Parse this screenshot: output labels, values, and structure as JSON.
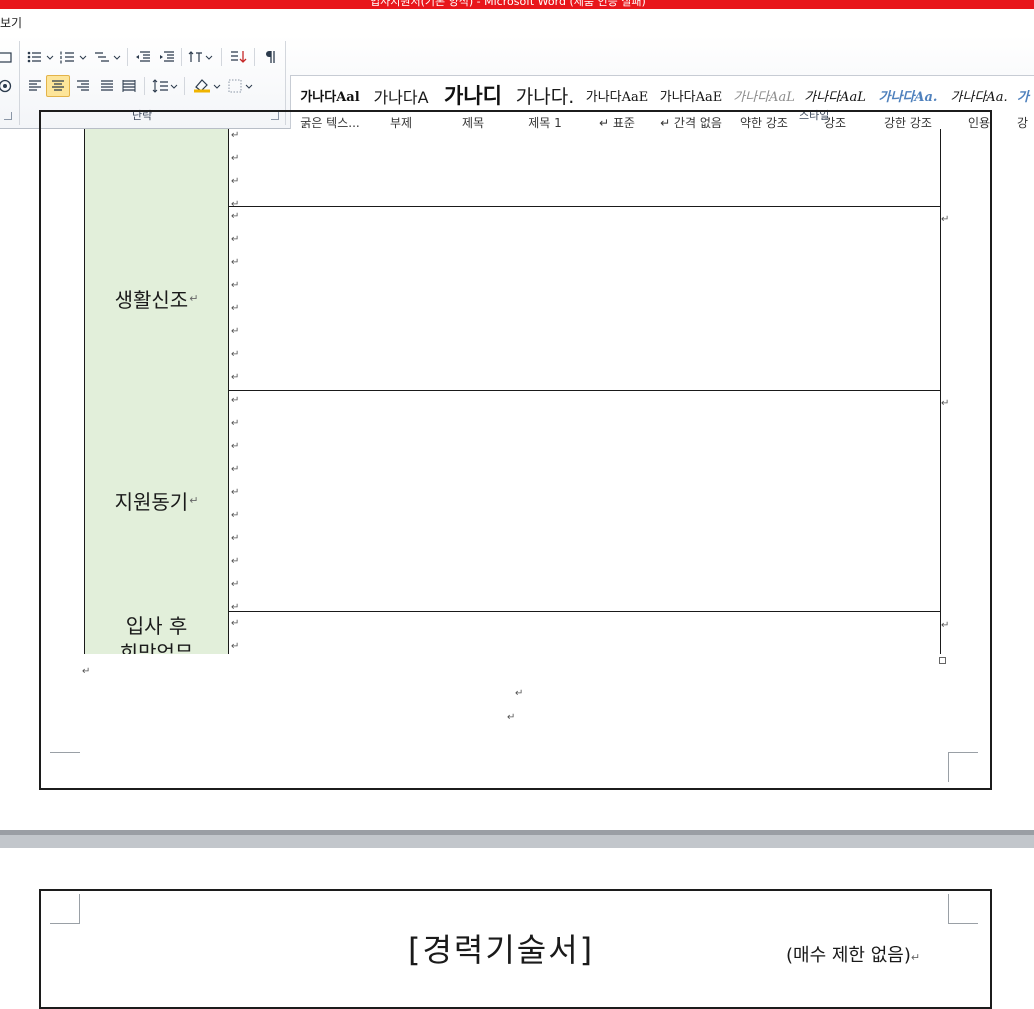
{
  "window": {
    "title": "입사지원서(기본 양식) - Microsoft Word (제품 인증 실패)"
  },
  "menu": {
    "tab_view": "보기"
  },
  "ribbon": {
    "paragraph_group_label": "단락",
    "styles_group_label": "스타일",
    "styles": [
      {
        "sample": "가나다Aal",
        "name": "굵은 텍스..."
      },
      {
        "sample": "가나다A",
        "name": "부제"
      },
      {
        "sample": "가나디",
        "name": "제목"
      },
      {
        "sample": "가나다.",
        "name": "제목 1"
      },
      {
        "sample": "가나다AaE",
        "name": "↵ 표준"
      },
      {
        "sample": "가나다AaE",
        "name": "↵ 간격 없음"
      },
      {
        "sample": "가나다AaL",
        "name": "약한 강조"
      },
      {
        "sample": "가나다AaL",
        "name": "강조"
      },
      {
        "sample": "가나다Aa.",
        "name": "강한 강조"
      },
      {
        "sample": "가나다Aa.",
        "name": "인용"
      },
      {
        "sample": "가",
        "name": "강"
      }
    ],
    "colors": {
      "active_button": "#fde59a",
      "title_bar": "#e8161b"
    }
  },
  "document": {
    "table": {
      "label_color": "#e2efda",
      "rows": [
        {
          "label": ""
        },
        {
          "label": "생활신조"
        },
        {
          "label": "지원동기"
        },
        {
          "label": "입사 후\n희망업무"
        }
      ]
    },
    "paragraph_mark": "↵",
    "page2": {
      "title": "[경력기술서]",
      "note": "(매수 제한 없음)"
    }
  }
}
